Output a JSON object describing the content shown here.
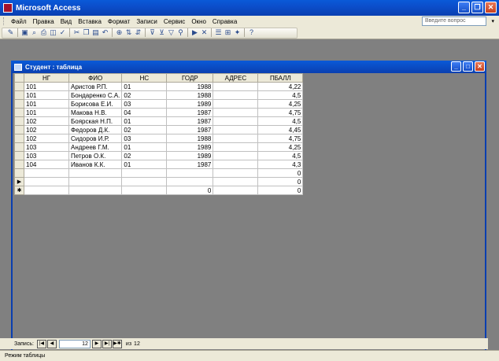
{
  "app": {
    "title": "Microsoft Access"
  },
  "menu": {
    "items": [
      "Файл",
      "Правка",
      "Вид",
      "Вставка",
      "Формат",
      "Записи",
      "Сервис",
      "Окно",
      "Справка"
    ],
    "help_placeholder": "Введите вопрос"
  },
  "toolbar": {
    "icons": [
      "design-view-icon",
      "save-icon",
      "search-icon",
      "print-icon",
      "print-preview-icon",
      "spelling-icon",
      "cut-icon",
      "copy-icon",
      "paste-icon",
      "undo-icon",
      "hyperlink-icon",
      "sort-ascending-icon",
      "sort-descending-icon",
      "filter-by-selection-icon",
      "filter-by-form-icon",
      "apply-filter-icon",
      "find-icon",
      "new-record-icon",
      "delete-record-icon",
      "properties-icon",
      "database-window-icon",
      "new-object-icon",
      "help-icon"
    ]
  },
  "table_window": {
    "title": "Студент : таблица",
    "columns": [
      "НГ",
      "ФИО",
      "НС",
      "ГОДР",
      "АДРЕС",
      "ПБАЛЛ"
    ],
    "rows": [
      [
        "101",
        "Аристов Р.П.",
        "01",
        "1988",
        "",
        "4,22"
      ],
      [
        "101",
        "Бондаренко С.А.",
        "02",
        "1988",
        "",
        "4,5"
      ],
      [
        "101",
        "Борисова Е.И.",
        "03",
        "1989",
        "",
        "4,25"
      ],
      [
        "101",
        "Макова Н.В.",
        "04",
        "1987",
        "",
        "4,75"
      ],
      [
        "102",
        "Боярская Н.П.",
        "01",
        "1987",
        "",
        "4,5"
      ],
      [
        "102",
        "Федоров Д.К.",
        "02",
        "1987",
        "",
        "4,45"
      ],
      [
        "102",
        "Сидоров И.Р.",
        "03",
        "1988",
        "",
        "4,75"
      ],
      [
        "103",
        "Андреев Г.М.",
        "01",
        "1989",
        "",
        "4,25"
      ],
      [
        "103",
        "Петров О.К.",
        "02",
        "1989",
        "",
        "4,5"
      ],
      [
        "104",
        "Иванов К.К.",
        "01",
        "1987",
        "",
        "4,3"
      ],
      [
        "",
        "",
        "",
        "",
        "",
        "0"
      ],
      [
        "",
        "",
        "",
        "",
        "",
        "0"
      ],
      [
        "",
        "",
        "",
        "0",
        "",
        "0"
      ]
    ],
    "row_markers": [
      "",
      "",
      "",
      "",
      "",
      "",
      "",
      "",
      "",
      "",
      "",
      "▶",
      "✱"
    ]
  },
  "navigator": {
    "label": "Запись:",
    "current": "12",
    "of_label": "из",
    "total": "12"
  },
  "status": {
    "text": "Режим таблицы"
  },
  "colors": {
    "title_bar": "#0a3fb0",
    "workspace": "#808080",
    "chrome": "#ece9d8"
  }
}
